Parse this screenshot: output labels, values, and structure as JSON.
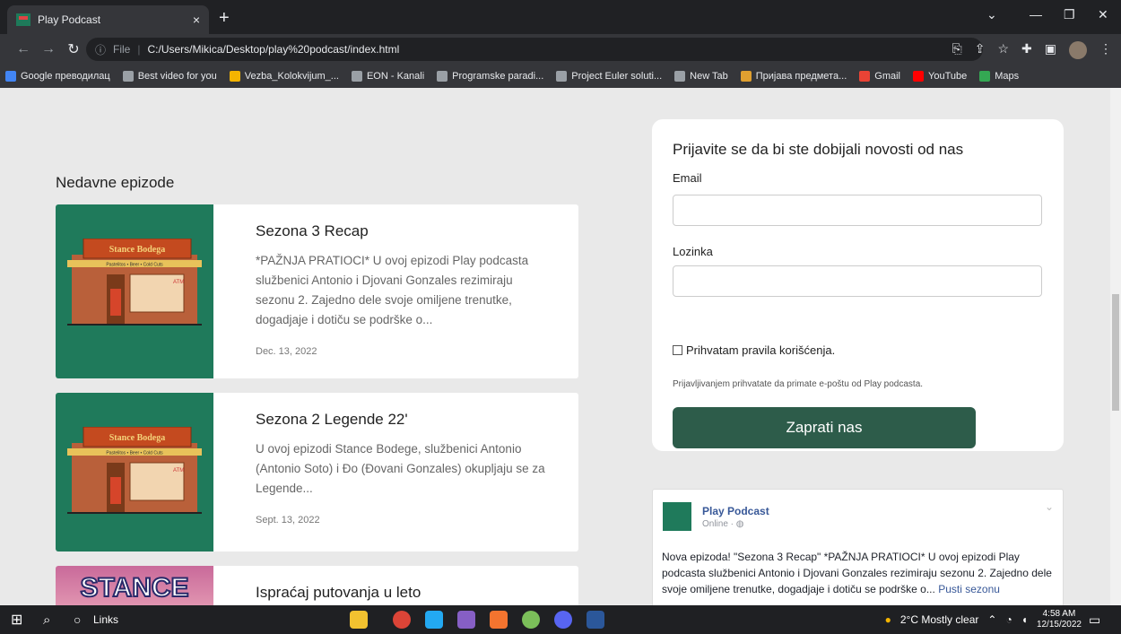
{
  "browser": {
    "tab_title": "Play Podcast",
    "tab_close": "×",
    "new_tab": "+",
    "url_scheme": "File",
    "url": "C:/Users/Mikica/Desktop/play%20podcast/index.html",
    "bookmarks": [
      {
        "label": "Google преводилац",
        "color": "#4285f4"
      },
      {
        "label": "Best video for you",
        "color": "#9aa0a6"
      },
      {
        "label": "Vezba_Kolokvijum_...",
        "color": "#f4b400"
      },
      {
        "label": "EON - Kanali",
        "color": "#9aa0a6"
      },
      {
        "label": "Programske paradi...",
        "color": "#9aa0a6"
      },
      {
        "label": "Project Euler soluti...",
        "color": "#9aa0a6"
      },
      {
        "label": "New Tab",
        "color": "#9aa0a6"
      },
      {
        "label": "Пријава предмета...",
        "color": "#e0a030"
      },
      {
        "label": "Gmail",
        "color": "#ea4335"
      },
      {
        "label": "YouTube",
        "color": "#ff0000"
      },
      {
        "label": "Maps",
        "color": "#34a853"
      }
    ]
  },
  "main": {
    "section_title": "Nedavne epizode",
    "episodes": [
      {
        "title": "Sezona 3 Recap",
        "description": "*PAŽNJA PRATIOCI* U ovoj epizodi Play podcasta službenici Antonio i Djovani Gonzales rezimiraju sezonu 2. Zajedno dele svoje omiljene trenutke, dogadjaje i dotiču se podrške o...",
        "date": "Dec. 13, 2022"
      },
      {
        "title": "Sezona 2 Legende 22'",
        "description": "U ovoj epizodi Stance Bodege, službenici Antonio (Antonio Soto) i Đo (Đovani Gonzales) okupljaju se za Legende...",
        "date": "Sept. 13, 2022"
      },
      {
        "title": "Ispraćaj putovanja u leto",
        "description": "",
        "date": ""
      }
    ],
    "shop_sign": "Stance Bodega",
    "shop_strip": "Pastelitos • Beer • Cold Cuts",
    "shop_atm": "ATM"
  },
  "subscribe": {
    "heading": "Prijavite se da bi ste dobijali novosti od nas",
    "email_label": "Email",
    "password_label": "Lozinka",
    "checkbox_label": "Prihvatam pravila korišćenja.",
    "note": "Prijavljivanjem prihvatate da primate e-poštu od Play podcasta.",
    "button_label": "Zaprati nas"
  },
  "facebook": {
    "page_name": "Play Podcast",
    "status": "Online · ◍",
    "post_text": "Nova epizoda! \"Sezona 3 Recap\" *PAŽNJA PRATIOCI* U ovoj epizodi Play podcasta službenici Antonio i Djovani Gonzales rezimiraju sezonu 2. Zajedno dele svoje omiljene trenutke, dogadjaje i dotiču se podrške o...",
    "more_link": "Pusti sezonu"
  },
  "taskbar": {
    "search_label": "Links",
    "weather": "2°C  Mostly clear",
    "time": "4:58 AM",
    "date": "12/15/2022"
  }
}
